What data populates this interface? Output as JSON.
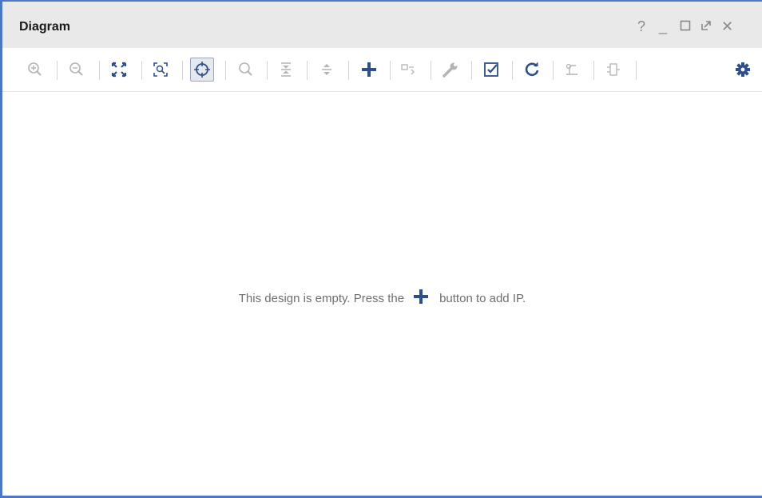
{
  "window": {
    "title": "Diagram",
    "controls": [
      {
        "name": "help",
        "glyph": "?"
      },
      {
        "name": "minimize",
        "glyph": "_"
      },
      {
        "name": "maximize",
        "glyph": "☐"
      },
      {
        "name": "float",
        "glyph": "⇗"
      },
      {
        "name": "close",
        "glyph": "✕"
      }
    ]
  },
  "toolbar": {
    "buttons": [
      {
        "icon": "zoom-in-icon",
        "enabled": false
      },
      {
        "icon": "zoom-out-icon",
        "enabled": false
      },
      {
        "icon": "zoom-fit-icon",
        "enabled": true
      },
      {
        "icon": "zoom-area-icon",
        "enabled": true
      },
      {
        "icon": "auto-fit-selection-icon",
        "enabled": true,
        "active": true
      },
      {
        "icon": "search-icon",
        "enabled": false
      },
      {
        "icon": "collapse-all-icon",
        "enabled": false
      },
      {
        "icon": "expand-all-icon",
        "enabled": false
      },
      {
        "icon": "add-ip-icon",
        "enabled": true
      },
      {
        "icon": "make-external-icon",
        "enabled": false
      },
      {
        "icon": "wrench-icon",
        "enabled": false
      },
      {
        "icon": "validate-design-icon",
        "enabled": true
      },
      {
        "icon": "regenerate-layout-icon",
        "enabled": true
      },
      {
        "icon": "optimize-routing-icon",
        "enabled": false
      },
      {
        "icon": "add-module-icon",
        "enabled": false
      },
      {
        "icon": "settings-gear-icon",
        "enabled": true
      }
    ]
  },
  "canvas": {
    "empty_message_before": "This design is empty. Press the",
    "empty_message_after": "button to add IP."
  },
  "colors": {
    "accent": "#4a78c2",
    "icon_active": "#2e4f87",
    "icon_disabled": "#b4b4b4",
    "titlebar": "#e9e9e9"
  }
}
